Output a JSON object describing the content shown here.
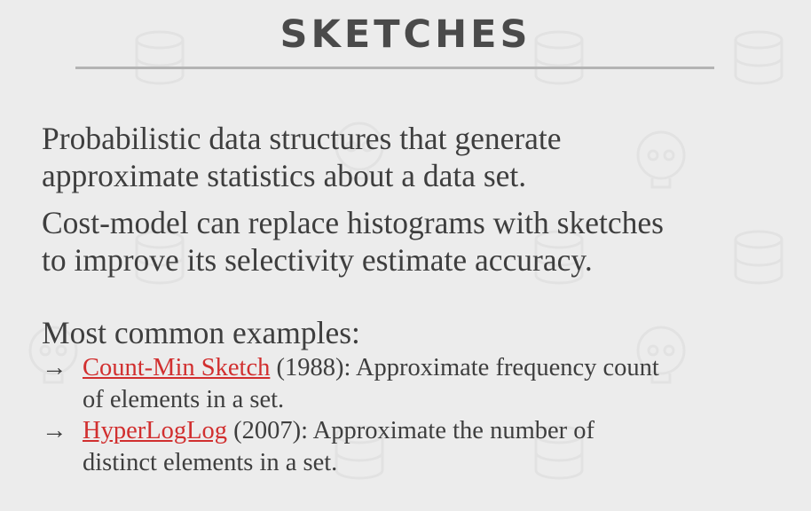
{
  "slide": {
    "title": "SKETCHES",
    "paragraphs": [
      {
        "line1": "Probabilistic data structures that generate",
        "line2": "approximate statistics about a data set."
      },
      {
        "line1": "Cost-model can replace histograms with sketches",
        "line2": "to improve its selectivity estimate accuracy."
      }
    ],
    "examples_heading": "Most common examples:",
    "examples": [
      {
        "arrow": "→",
        "link_text": "Count-Min Sketch",
        "line1_rest": " (1988): Approximate frequency count",
        "line2": "of elements in a set."
      },
      {
        "arrow": "→",
        "link_text": "HyperLogLog",
        "line1_rest": " (2007): Approximate the number of",
        "line2": "distinct elements in a set."
      }
    ]
  },
  "colors": {
    "background": "#ececec",
    "text": "#3e3e3e",
    "link": "#d12f2f",
    "rule": "#b4b4b4"
  }
}
